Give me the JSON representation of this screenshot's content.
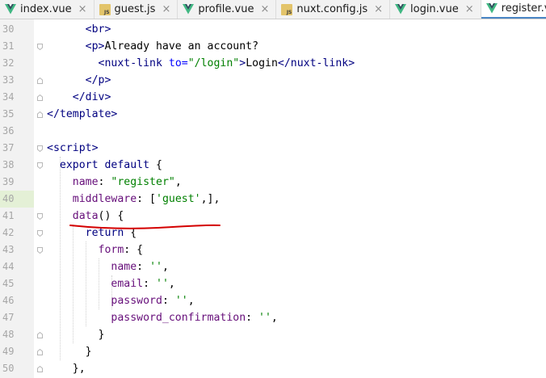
{
  "tabs": [
    {
      "label": "index.vue",
      "icon": "vue-icon",
      "active": false
    },
    {
      "label": "guest.js",
      "icon": "js-file-icon",
      "active": false
    },
    {
      "label": "profile.vue",
      "icon": "vue-icon",
      "active": false
    },
    {
      "label": "nuxt.config.js",
      "icon": "js-file-icon",
      "active": false
    },
    {
      "label": "login.vue",
      "icon": "vue-icon",
      "active": false
    },
    {
      "label": "register.vue",
      "icon": "vue-icon",
      "active": true
    },
    {
      "label": "",
      "icon": "js-file-icon",
      "active": false
    }
  ],
  "close_glyph": "×",
  "colors": {
    "vue_green": "#41b883",
    "vue_dark": "#35495e",
    "active_tab_underline": "#4a86c5",
    "annotation_red": "#d40000"
  },
  "lines": [
    {
      "num": "30",
      "tokens": [
        [
          "c-plain",
          "      "
        ],
        [
          "c-tag",
          "<br>"
        ]
      ]
    },
    {
      "num": "31",
      "tokens": [
        [
          "c-plain",
          "      "
        ],
        [
          "c-tag",
          "<p>"
        ],
        [
          "c-plain",
          "Already have an account?"
        ]
      ]
    },
    {
      "num": "32",
      "tokens": [
        [
          "c-plain",
          "        "
        ],
        [
          "c-tag",
          "<nuxt-link "
        ],
        [
          "c-attr",
          "to="
        ],
        [
          "c-str",
          "\"/login\""
        ],
        [
          "c-tag",
          ">"
        ],
        [
          "c-plain",
          "Login"
        ],
        [
          "c-tag",
          "</nuxt-link>"
        ]
      ]
    },
    {
      "num": "33",
      "tokens": [
        [
          "c-plain",
          "      "
        ],
        [
          "c-tag",
          "</p>"
        ]
      ]
    },
    {
      "num": "34",
      "tokens": [
        [
          "c-plain",
          "    "
        ],
        [
          "c-tag",
          "</div>"
        ]
      ]
    },
    {
      "num": "35",
      "tokens": [
        [
          "c-tag",
          "</template>"
        ]
      ]
    },
    {
      "num": "36",
      "tokens": []
    },
    {
      "num": "37",
      "tokens": [
        [
          "c-tag",
          "<script>"
        ]
      ]
    },
    {
      "num": "38",
      "tokens": [
        [
          "c-plain",
          "  "
        ],
        [
          "c-kw",
          "export default "
        ],
        [
          "c-plain",
          "{"
        ]
      ]
    },
    {
      "num": "39",
      "tokens": [
        [
          "c-plain",
          "    "
        ],
        [
          "c-prop",
          "name"
        ],
        [
          "c-plain",
          ": "
        ],
        [
          "c-str",
          "\"register\""
        ],
        [
          "c-plain",
          ","
        ]
      ]
    },
    {
      "num": "40",
      "tokens": [
        [
          "c-plain",
          "    "
        ],
        [
          "c-prop",
          "middleware"
        ],
        [
          "c-plain",
          ": ["
        ],
        [
          "c-str",
          "'guest'"
        ],
        [
          "c-plain",
          ",],"
        ]
      ]
    },
    {
      "num": "41",
      "tokens": [
        [
          "c-plain",
          "    "
        ],
        [
          "c-prop",
          "data"
        ],
        [
          "c-plain",
          "() {"
        ]
      ]
    },
    {
      "num": "42",
      "tokens": [
        [
          "c-plain",
          "      "
        ],
        [
          "c-kw",
          "return "
        ],
        [
          "c-plain",
          "{"
        ]
      ]
    },
    {
      "num": "43",
      "tokens": [
        [
          "c-plain",
          "        "
        ],
        [
          "c-prop",
          "form"
        ],
        [
          "c-plain",
          ": {"
        ]
      ]
    },
    {
      "num": "44",
      "tokens": [
        [
          "c-plain",
          "          "
        ],
        [
          "c-prop",
          "name"
        ],
        [
          "c-plain",
          ": "
        ],
        [
          "c-str",
          "''"
        ],
        [
          "c-plain",
          ","
        ]
      ]
    },
    {
      "num": "45",
      "tokens": [
        [
          "c-plain",
          "          "
        ],
        [
          "c-prop",
          "email"
        ],
        [
          "c-plain",
          ": "
        ],
        [
          "c-str",
          "''"
        ],
        [
          "c-plain",
          ","
        ]
      ]
    },
    {
      "num": "46",
      "tokens": [
        [
          "c-plain",
          "          "
        ],
        [
          "c-prop",
          "password"
        ],
        [
          "c-plain",
          ": "
        ],
        [
          "c-str",
          "''"
        ],
        [
          "c-plain",
          ","
        ]
      ]
    },
    {
      "num": "47",
      "tokens": [
        [
          "c-plain",
          "          "
        ],
        [
          "c-prop",
          "password_confirmation"
        ],
        [
          "c-plain",
          ": "
        ],
        [
          "c-str",
          "''"
        ],
        [
          "c-plain",
          ","
        ]
      ]
    },
    {
      "num": "48",
      "tokens": [
        [
          "c-plain",
          "        }"
        ]
      ]
    },
    {
      "num": "49",
      "tokens": [
        [
          "c-plain",
          "      }"
        ]
      ]
    },
    {
      "num": "50",
      "tokens": [
        [
          "c-plain",
          "    },"
        ]
      ]
    }
  ]
}
